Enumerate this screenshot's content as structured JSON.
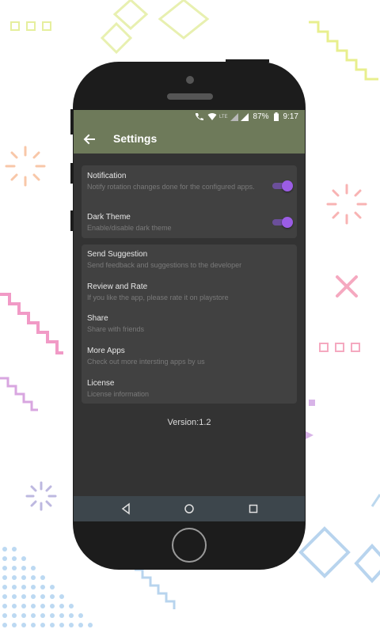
{
  "status_bar": {
    "battery": "87%",
    "time": "9:17",
    "net_label": "LTE"
  },
  "app_bar": {
    "title": "Settings"
  },
  "settings_group_1": [
    {
      "title": "Notification",
      "subtitle": "Notify rotation changes done for the configured apps.",
      "enabled": true
    },
    {
      "title": "Dark Theme",
      "subtitle": "Enable/disable dark theme",
      "enabled": true
    }
  ],
  "settings_group_2": [
    {
      "title": "Send Suggestion",
      "subtitle": "Send feedback and suggestions to the developer"
    },
    {
      "title": "Review and Rate",
      "subtitle": "If you like the app, please rate it on playstore"
    },
    {
      "title": "Share",
      "subtitle": "Share with friends"
    },
    {
      "title": "More Apps",
      "subtitle": "Check out more intersting apps by us"
    },
    {
      "title": "License",
      "subtitle": "License information"
    }
  ],
  "version_text": "Version:1.2",
  "colors": {
    "appbar": "#6e7a5a",
    "screen_bg": "#333333",
    "card_bg": "#414141",
    "toggle_accent": "#9b5de5"
  },
  "icons": {
    "back": "arrow-left-icon",
    "nav_back": "triangle-back-icon",
    "nav_home": "circle-home-icon",
    "nav_recents": "square-recents-icon"
  }
}
